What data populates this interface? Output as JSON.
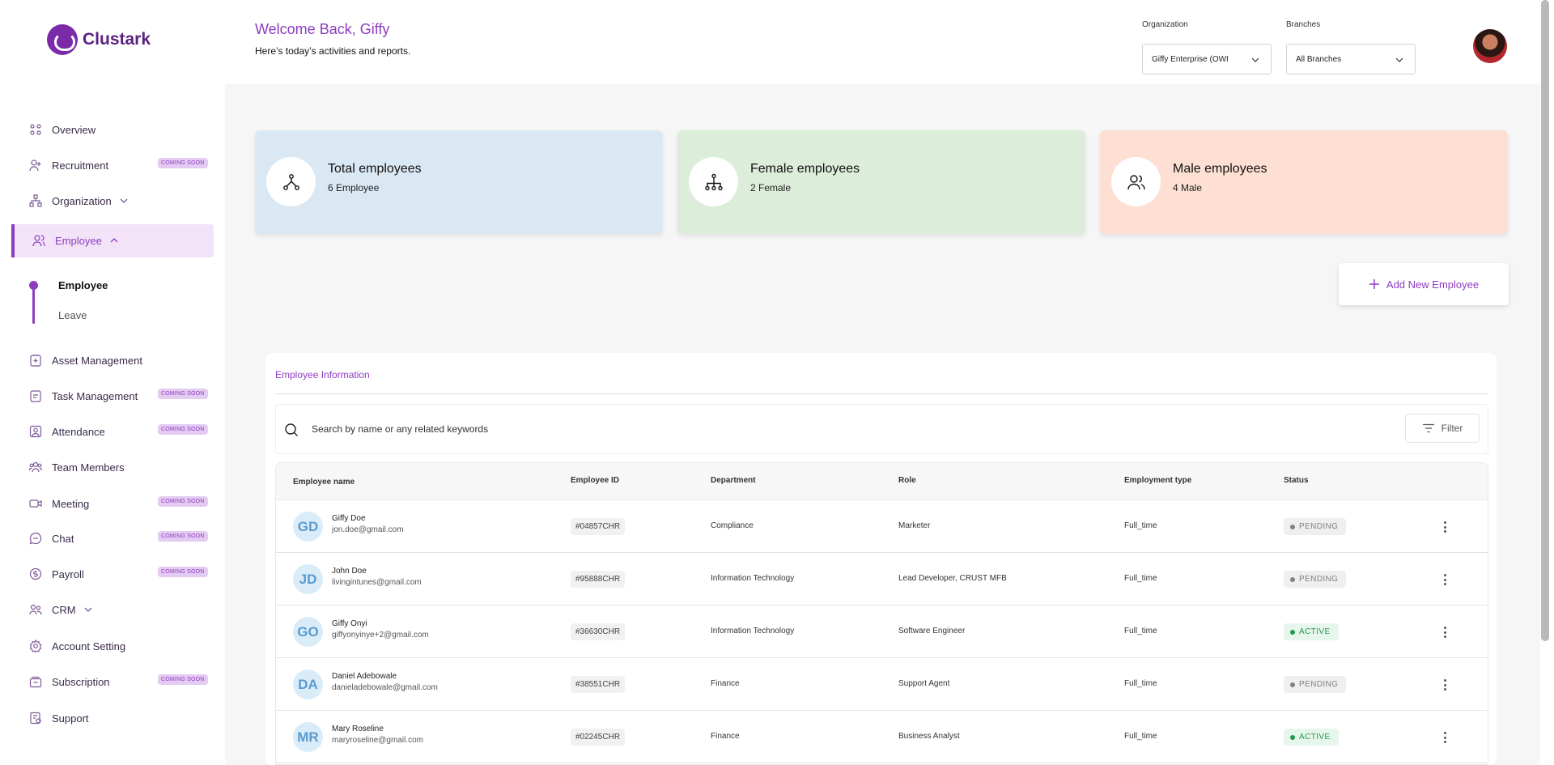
{
  "app": {
    "name": "Clustark"
  },
  "header": {
    "welcome": "Welcome Back, Giffy",
    "subtitle": "Here’s today’s activities and reports.",
    "organization_label": "Organization",
    "organization_value": "Giffy Enterprise (OWI",
    "branches_label": "Branches",
    "branches_value": "All Branches"
  },
  "sidebar": {
    "items": [
      {
        "label": "Overview"
      },
      {
        "label": "Recruitment",
        "badge": "COMING SOON"
      },
      {
        "label": "Organization"
      },
      {
        "label": "Employee"
      },
      {
        "label": "Asset Management"
      },
      {
        "label": "Task Management",
        "badge": "COMING SOON"
      },
      {
        "label": "Attendance",
        "badge": "COMING SOON"
      },
      {
        "label": "Team Members"
      },
      {
        "label": "Meeting",
        "badge": "COMING SOON"
      },
      {
        "label": "Chat",
        "badge": "COMING SOON"
      },
      {
        "label": "Payroll",
        "badge": "COMING SOON"
      },
      {
        "label": "CRM"
      },
      {
        "label": "Account Setting"
      },
      {
        "label": "Subscription",
        "badge": "COMING SOON"
      },
      {
        "label": "Support"
      }
    ],
    "sub_items": [
      {
        "label": "Employee"
      },
      {
        "label": "Leave"
      }
    ]
  },
  "cards": [
    {
      "title": "Total employees",
      "value": "6 Employee",
      "color": "#dae8f3"
    },
    {
      "title": "Female employees",
      "value": "2 Female",
      "color": "#dcedd9"
    },
    {
      "title": "Male employees",
      "value": "4 Male",
      "color": "#fde0d3"
    }
  ],
  "add_button": "Add New Employee",
  "panel": {
    "title": "Employee Information",
    "search_placeholder": "Search by name or any related keywords",
    "filter_label": "Filter"
  },
  "table": {
    "columns": [
      "Employee name",
      "Employee ID",
      "Department",
      "Role",
      "Employment type",
      "Status"
    ],
    "rows": [
      {
        "initials": "GD",
        "name": "Giffy Doe",
        "email": "jon.doe@gmail.com",
        "id": "#04857CHR",
        "department": "Compliance",
        "role": "Marketer",
        "type": "Full_time",
        "status": "PENDING"
      },
      {
        "initials": "JD",
        "name": "John Doe",
        "email": "livingintunes@gmail.com",
        "id": "#95888CHR",
        "department": "Information Technology",
        "role": "Lead Developer, CRUST MFB",
        "type": "Full_time",
        "status": "PENDING"
      },
      {
        "initials": "GO",
        "name": "Giffy Onyi",
        "email": "giffyonyinye+2@gmail.com",
        "id": "#36630CHR",
        "department": "Information Technology",
        "role": "Software Engineer",
        "type": "Full_time",
        "status": "ACTIVE"
      },
      {
        "initials": "DA",
        "name": "Daniel Adebowale",
        "email": "danieladebowale@gmail.com",
        "id": "#38551CHR",
        "department": "Finance",
        "role": "Support Agent",
        "type": "Full_time",
        "status": "PENDING"
      },
      {
        "initials": "MR",
        "name": "Mary Roseline",
        "email": "maryroseline@gmail.com",
        "id": "#02245CHR",
        "department": "Finance",
        "role": "Business Analyst",
        "type": "Full_time",
        "status": "ACTIVE"
      }
    ]
  },
  "colors": {
    "accent": "#8e3cc0",
    "pending_bg": "#efefef",
    "pending_fg": "#808080",
    "active_bg": "#e7f6ec",
    "active_fg": "#1f9a4c"
  }
}
